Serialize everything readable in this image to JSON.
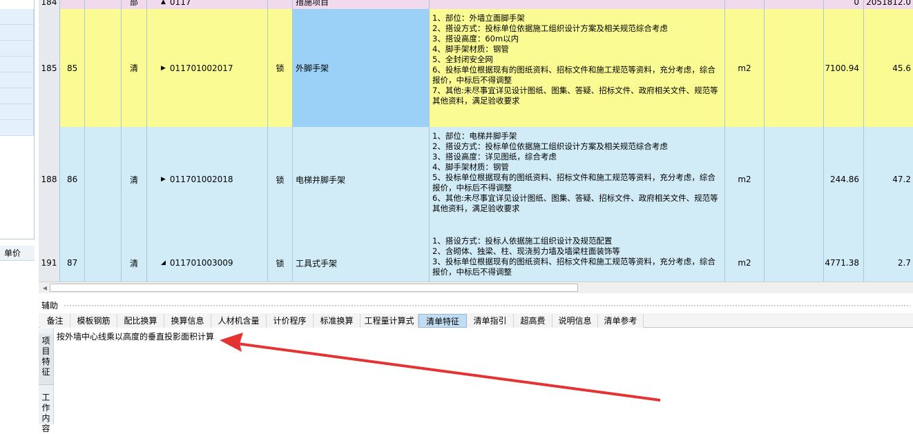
{
  "grid": {
    "rows": [
      {
        "row_no": "184",
        "seq": "",
        "type": "部",
        "code": "0117",
        "code_marker": "▲",
        "lock": "",
        "name": "措施项目",
        "feature": "",
        "unit": "",
        "qty": "0",
        "price": "2051812.0",
        "bg": "#f1d9ee"
      },
      {
        "row_no": "185",
        "seq": "85",
        "type": "清",
        "code": "011701002017",
        "code_marker": "▶",
        "lock": "锁",
        "name": "外脚手架",
        "feature": "1、部位：外墙立面脚手架\n2、搭设方式：投标单位依据施工组织设计方案及相关规范综合考虑\n3、搭设高度：60m以内\n4、脚手架材质：钢管\n5、全封闭安全网\n6、投标单位根据现有的图纸资料、招标文件和施工规范等资料，充分考虑，综合报价，中标后不得调整\n7、其他:未尽事宜详见设计图纸、图集、答疑、招标文件、政府相关文件、规范等其他资料，满足验收要求",
        "unit": "m2",
        "qty": "7100.94",
        "price": "45.6",
        "bg": "#fbfb93",
        "name_bg": "#9cd1f7"
      },
      {
        "row_no": "188",
        "seq": "86",
        "type": "清",
        "code": "011701002018",
        "code_marker": "▶",
        "lock": "锁",
        "name": "电梯井脚手架",
        "feature": "1、部位：电梯井脚手架\n2、搭设方式：投标单位依据施工组织设计方案及相关规范综合考虑\n3、搭设高度：详见图纸，综合考虑\n4、脚手架材质：钢管\n5、投标单位根据现有的图纸资料、招标文件和施工规范等资料，充分考虑，综合报价，中标后不得调整\n6、其他:未尽事宜详见设计图纸、图集、答疑、招标文件、政府相关文件、规范等其他资料，满足验收要求",
        "unit": "m2",
        "qty": "244.86",
        "price": "47.2",
        "bg": "#d2ecf7"
      },
      {
        "row_no": "191",
        "seq": "87",
        "type": "清",
        "code": "011701003009",
        "code_marker": "◢",
        "lock": "锁",
        "name": "工具式手架",
        "feature": "1、搭设方式：投标人依据施工组织设计及规范配置\n2、含砌体、独梁、柱、现浇剪力墙及墙梁柱面装饰等\n3、投标单位根据现有的图纸资料、招标文件和施工规范等资料，充分考虑，综合报价，中标后不得调整",
        "unit": "m2",
        "qty": "4771.38",
        "price": "2.7",
        "bg": "#d2ecf7"
      }
    ]
  },
  "left_panel": {
    "unit_price_label": "单价"
  },
  "aux": {
    "label": "辅助",
    "tabs": [
      "备注",
      "模板钢筋",
      "配比换算",
      "换算信息",
      "人材机含量",
      "计价程序",
      "标准换算",
      "工程量计算式",
      "清单特征",
      "清单指引",
      "超高费",
      "说明信息",
      "清单参考"
    ],
    "active_tab": "清单特征",
    "side_tabs": [
      "项目特征",
      "工作内容"
    ],
    "feature_text": "按外墙中心线乘以高度的垂直投影面积计算"
  },
  "colors": {
    "arrow": "#e53333",
    "active_tab": "#c2dcf2"
  }
}
